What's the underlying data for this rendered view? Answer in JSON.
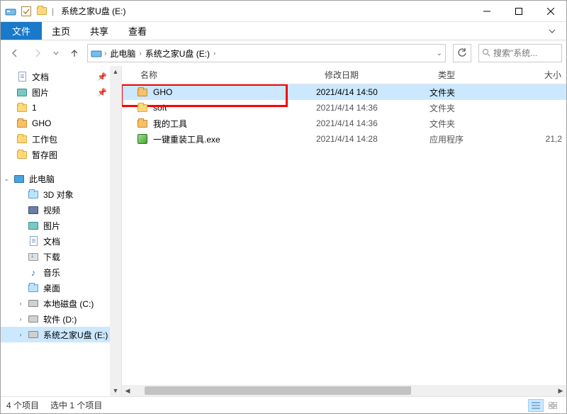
{
  "titlebar": {
    "title": "系统之家U盘 (E:)"
  },
  "ribbon": {
    "file": "文件",
    "tabs": [
      "主页",
      "共享",
      "查看"
    ]
  },
  "address": {
    "crumbs": [
      "此电脑",
      "系统之家U盘 (E:)"
    ],
    "search_placeholder": "搜索\"系统..."
  },
  "nav": {
    "items": [
      {
        "label": "文档",
        "icon": "doc",
        "pinned": true,
        "indent": 1
      },
      {
        "label": "图片",
        "icon": "pic",
        "pinned": true,
        "indent": 1
      },
      {
        "label": "1",
        "icon": "folder",
        "indent": 1
      },
      {
        "label": "GHO",
        "icon": "folder-orange",
        "indent": 1
      },
      {
        "label": "工作包",
        "icon": "folder",
        "indent": 1
      },
      {
        "label": "暂存图",
        "icon": "folder",
        "indent": 1
      }
    ],
    "pc_label": "此电脑",
    "pc_children": [
      {
        "label": "3D 对象",
        "icon": "folder-blue"
      },
      {
        "label": "视频",
        "icon": "vid"
      },
      {
        "label": "图片",
        "icon": "pic"
      },
      {
        "label": "文档",
        "icon": "doc"
      },
      {
        "label": "下载",
        "icon": "dl"
      },
      {
        "label": "音乐",
        "icon": "music"
      },
      {
        "label": "桌面",
        "icon": "folder-blue"
      },
      {
        "label": "本地磁盘 (C:)",
        "icon": "drive",
        "expandable": true
      },
      {
        "label": "软件 (D:)",
        "icon": "drive",
        "expandable": true
      },
      {
        "label": "系统之家U盘 (E:)",
        "icon": "drive-usb",
        "expandable": true,
        "selected": true
      }
    ]
  },
  "columns": {
    "name": "名称",
    "date": "修改日期",
    "type": "类型",
    "size": "大小"
  },
  "files": [
    {
      "name": "GHO",
      "date": "2021/4/14 14:50",
      "type": "文件夹",
      "size": "",
      "icon": "folder-orange",
      "selected": true,
      "highlight": true
    },
    {
      "name": "soft",
      "date": "2021/4/14 14:36",
      "type": "文件夹",
      "size": "",
      "icon": "folder"
    },
    {
      "name": "我的工具",
      "date": "2021/4/14 14:36",
      "type": "文件夹",
      "size": "",
      "icon": "folder-orange"
    },
    {
      "name": "一键重装工具.exe",
      "date": "2021/4/14 14:28",
      "type": "应用程序",
      "size": "21,2",
      "icon": "app"
    }
  ],
  "status": {
    "count": "4 个项目",
    "selected": "选中 1 个项目"
  }
}
